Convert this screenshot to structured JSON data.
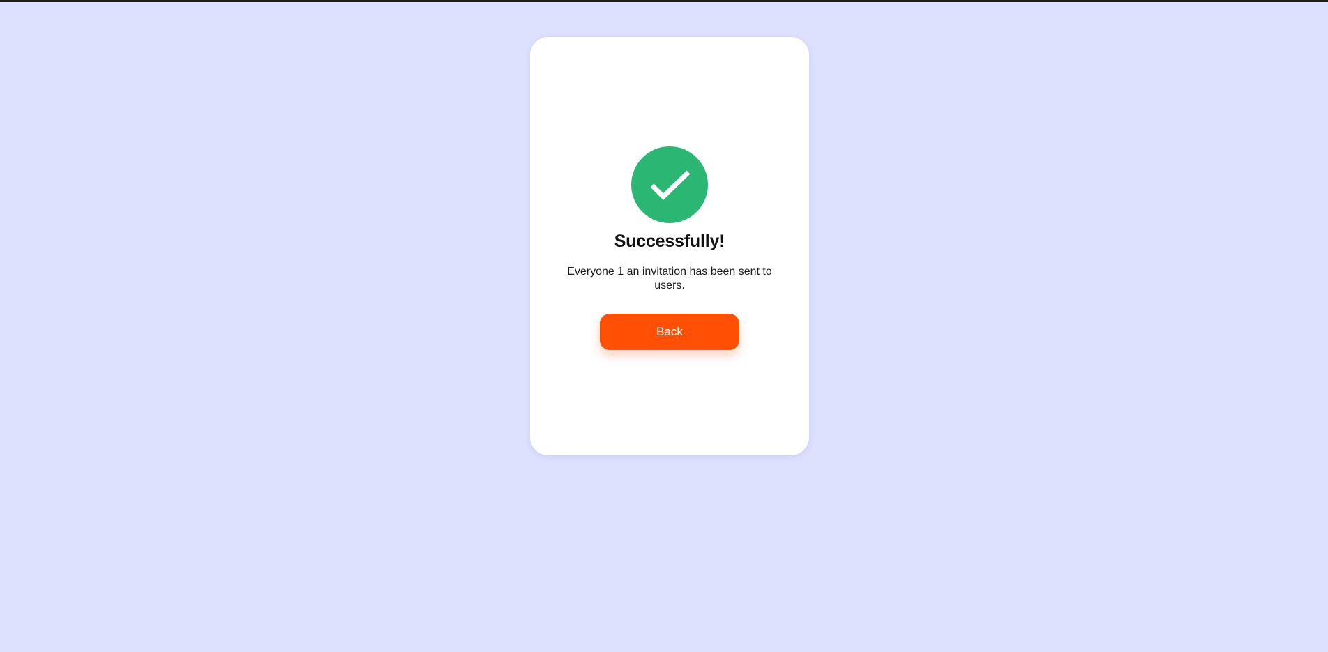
{
  "colors": {
    "background": "#dee1fe",
    "card": "#ffffff",
    "success_green": "#2bb673",
    "accent_orange": "#ff5005"
  },
  "dialog": {
    "icon": "checkmark-circle-icon",
    "title": "Successfully!",
    "message": "Everyone 1 an invitation has been sent to users.",
    "back_label": "Back"
  }
}
